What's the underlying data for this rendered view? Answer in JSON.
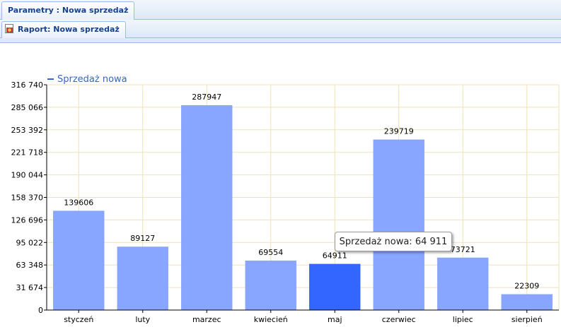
{
  "tabs": {
    "main_tab_label": "Parametry : Nowa sprzedaż",
    "report_tab_label": "Raport: Nowa sprzedaż"
  },
  "icons": {
    "report_tab_icon": "report-icon"
  },
  "colors": {
    "bar": "#88a6ff",
    "bar_highlight": "#3366ff",
    "grid": "#f1e2b4",
    "legend": "#3366cc",
    "axis": "#000000"
  },
  "chart_data": {
    "type": "bar",
    "categories": [
      "styczeń",
      "luty",
      "marzec",
      "kwiecień",
      "maj",
      "czerwiec",
      "lipiec",
      "sierpień"
    ],
    "series": [
      {
        "name": "Sprzedaż nowa",
        "values": [
          139606,
          89127,
          287947,
          69554,
          64911,
          239719,
          73721,
          22309
        ]
      }
    ],
    "data_labels": [
      "139606",
      "89127",
      "287947",
      "69554",
      "64911",
      "239719",
      "73721",
      "22309"
    ],
    "y_ticks": [
      "0",
      "31 674",
      "63 348",
      "95 022",
      "126 696",
      "158 370",
      "190 044",
      "221 718",
      "253 392",
      "285 066",
      "316 740"
    ],
    "ylim": [
      0,
      316740
    ],
    "grid": true,
    "legend_position": "top-left",
    "highlighted_index": 4,
    "tooltip": "Sprzedaż nowa: 64 911"
  }
}
